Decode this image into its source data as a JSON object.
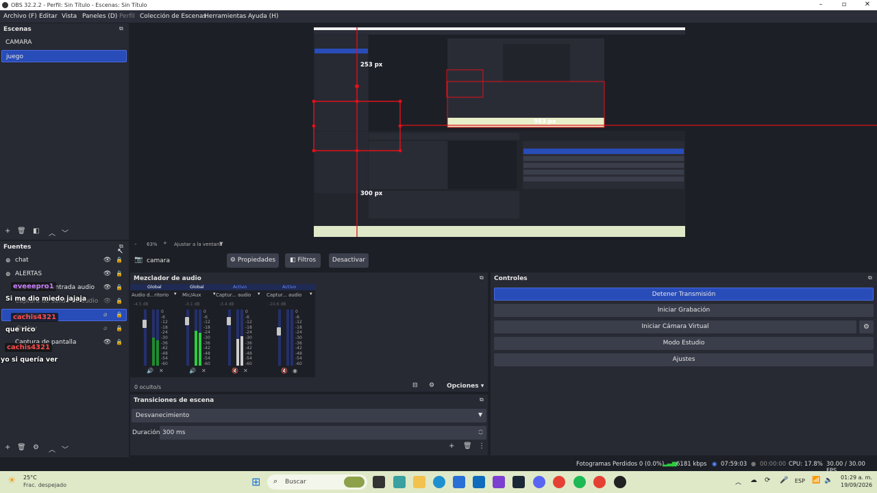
{
  "window": {
    "title": "OBS 32.2.2 - Perfil: Sin Título - Escenas: Sin Título"
  },
  "menu": [
    {
      "label": "Archivo (F)"
    },
    {
      "label": "Editar"
    },
    {
      "label": "Vista"
    },
    {
      "label": "Paneles (D)"
    },
    {
      "label": "Perfil"
    },
    {
      "label": "Colección de Escenas"
    },
    {
      "label": "Herramientas"
    },
    {
      "label": "Ayuda (H)"
    }
  ],
  "scenes": {
    "header": "Escenas",
    "items": [
      "CAMARA",
      "juego"
    ],
    "selected": "juego"
  },
  "preview": {
    "label_253": "253 px",
    "label_983": "983 px",
    "label_300": "300 px",
    "zoom": "63%",
    "fit": "Ajustar a la ventana"
  },
  "sources": {
    "header": "Fuentes",
    "items": [
      "chat",
      "ALERTAS",
      "Captura de entrada audio",
      "Captura de salida de audio",
      "camara",
      "display",
      "Captura de pantalla"
    ],
    "selected": "camara"
  },
  "chat_overlay": [
    {
      "name": "eveeepro1",
      "msg": "Si me dio miedo jajaja"
    },
    {
      "name": "cachis4321",
      "msg": "que rico"
    },
    {
      "name": "cachis4321",
      "msg": "yo si quería ver"
    }
  ],
  "source_bar": {
    "name": "camara",
    "props": "Propiedades",
    "filters": "Filtros",
    "deactivate": "Desactivar"
  },
  "mixer": {
    "header": "Mezclador de audio",
    "channels": [
      {
        "tag": "Global",
        "name": "Audio d...ritorio",
        "db": "-4.5 dB"
      },
      {
        "tag": "Global",
        "name": "Mic/Aux",
        "db": "-3.1 dB"
      },
      {
        "tag": "Activo",
        "name": "Captur... audio",
        "db": "-3.4 dB"
      },
      {
        "tag": "Activo",
        "name": "Captur... audio",
        "db": "-10.6 dB"
      }
    ],
    "scale": [
      "0",
      "-6",
      "-12",
      "-18",
      "-24",
      "-30",
      "-36",
      "-42",
      "-48",
      "-54",
      "-60"
    ],
    "hidden": "0 oculto/s",
    "options": "Opciones"
  },
  "transitions": {
    "header": "Transiciones de escena",
    "selected": "Desvanecimiento",
    "duration_label": "Duración",
    "duration_value": "300 ms"
  },
  "controls": {
    "header": "Controles",
    "buttons": [
      "Detener Transmisión",
      "Iniciar Grabación",
      "Iniciar Cámara Virtual",
      "Modo Estudio",
      "Ajustes"
    ]
  },
  "status": {
    "dropped": "Fotogramas Perdidos 0 (0.0%)",
    "bitrate": "6181 kbps",
    "stream_time": "07:59:03",
    "rec_time": "00:00:00",
    "cpu": "CPU: 17.8%",
    "fps": "30.00 / 30.00 FPS"
  },
  "taskbar": {
    "weather_temp": "25°C",
    "weather_desc": "Frac. despejado",
    "search": "Buscar",
    "lang": "ESP",
    "time": "01:29 a. m.",
    "date": "19/09/2026"
  },
  "colors": {
    "accent": "#284cb8",
    "panel": "#272a33",
    "bg": "#1d1f26",
    "meter_green": "#2ecc40",
    "guide_red": "#e0101a"
  }
}
